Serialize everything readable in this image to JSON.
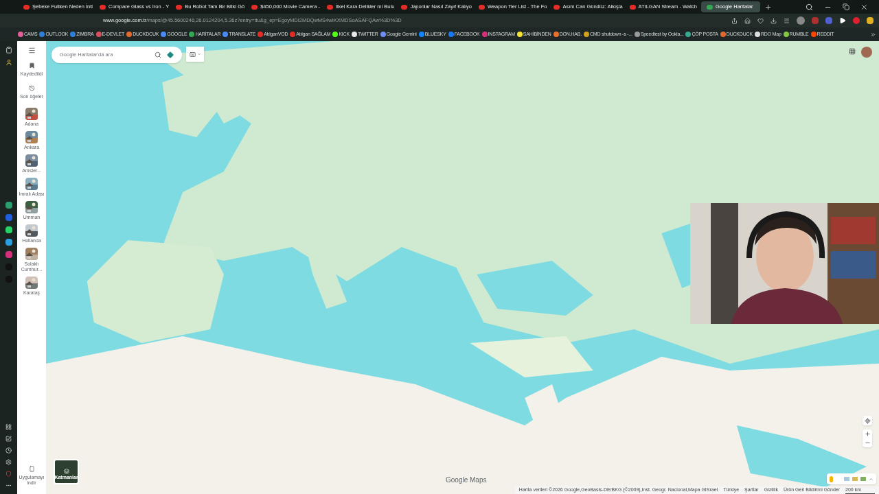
{
  "tabs": [
    {
      "title": "Şebeke Fullken Neden İnti",
      "selected": false
    },
    {
      "title": "Compare Glass vs Iron - Y",
      "selected": false
    },
    {
      "title": "Bu Robot Tam Bir Bitki Gö",
      "selected": false
    },
    {
      "title": "$450,000 Movie Camera -",
      "selected": false
    },
    {
      "title": "İlkel Kara Delikler mi Bulu",
      "selected": false
    },
    {
      "title": "Japonlar Nasıl Zayıf Kalıyo",
      "selected": false
    },
    {
      "title": "Weapon Tier List - The Fo",
      "selected": false
    },
    {
      "title": "Asım Can Gündüz: Alkışla",
      "selected": false
    },
    {
      "title": "ATILGAN Stream - Watch",
      "selected": false
    },
    {
      "title": "Google Haritalar",
      "selected": true
    }
  ],
  "address_bar": {
    "url_host": "www.google.com.tr",
    "url_path": "/maps/@45.5600246,26.0124204,5.36z?entry=ttu&g_ep=EgoyMDI2MDQwMS4wIKXMDSoASAFQAw%3D%3D"
  },
  "bookmarks": [
    {
      "label": "CAMS",
      "color": "#e0609a"
    },
    {
      "label": "OUTLOOK",
      "color": "#2f7fd8"
    },
    {
      "label": "ZIMBRA",
      "color": "#2f7fd8"
    },
    {
      "label": "E-DEVLET",
      "color": "#d65060"
    },
    {
      "label": "DUCKDCUK",
      "color": "#e26a30"
    },
    {
      "label": "GOOGLE",
      "color": "#4a8af4"
    },
    {
      "label": "HARİTALAR",
      "color": "#34a853"
    },
    {
      "label": "TRANSLATE",
      "color": "#4a8af4"
    },
    {
      "label": "AtılganVOD",
      "color": "#e52d27"
    },
    {
      "label": "Atılgan SAĞLAM",
      "color": "#e52d27"
    },
    {
      "label": "KICK",
      "color": "#53fc18"
    },
    {
      "label": "TWITTER",
      "color": "#e8e8e8"
    },
    {
      "label": "Google Gemini",
      "color": "#6f8ff5"
    },
    {
      "label": "BLUESKY",
      "color": "#1185fe"
    },
    {
      "label": "FACEBOOK",
      "color": "#1877f2"
    },
    {
      "label": "INSTAGRAM",
      "color": "#d6307a"
    },
    {
      "label": "SAHİBİNDEN",
      "color": "#f5e332"
    },
    {
      "label": "DON.HAB.",
      "color": "#e8702a"
    },
    {
      "label": "CMD shutdown -s -...",
      "color": "#d0a020"
    },
    {
      "label": "Speedtest by Ookla...",
      "color": "#9a9a9a"
    },
    {
      "label": "ÇÖP POSTA",
      "color": "#3aa890"
    },
    {
      "label": "DUCKDUCK",
      "color": "#e26a30"
    },
    {
      "label": "RDO Map",
      "color": "#dddddd"
    },
    {
      "label": "RUMBLE",
      "color": "#85c742"
    },
    {
      "label": "REDDIT",
      "color": "#ff4500"
    }
  ],
  "maps": {
    "search": {
      "placeholder": "Google Haritalar'da ara"
    },
    "rail": [
      {
        "label": "Kaydedildi",
        "kind": "saved"
      },
      {
        "label": "Son öğeler",
        "kind": "recent"
      }
    ],
    "places": [
      {
        "label": "Adana"
      },
      {
        "label": "Ankara"
      },
      {
        "label": "Amster..."
      },
      {
        "label": "İmralı Adası"
      },
      {
        "label": "Umman"
      },
      {
        "label": "Hollanda"
      },
      {
        "label": "Solaklı Cumhur..."
      },
      {
        "label": "Karataş"
      }
    ],
    "download_app": "Uygulamayı indir",
    "layers": "Katmanlar",
    "logo": "Google Maps",
    "footer": [
      "Harita verileri ©2026 Google,GeoBasis-DE/BKG (©2009),Inst. Geogr. Nacional,Mapa GISrael",
      "Türkiye",
      "Şartlar",
      "Gizlilik",
      "Ürün Geri Bildirimi Gönder"
    ],
    "scale": "200 km"
  }
}
